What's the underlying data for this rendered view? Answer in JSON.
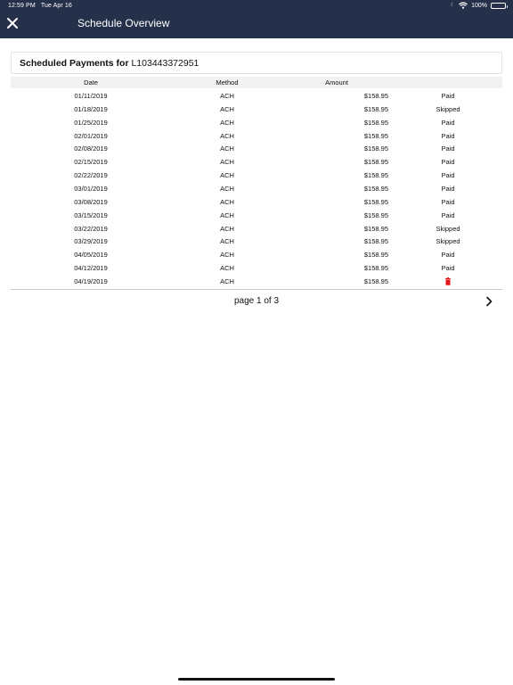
{
  "status_bar": {
    "time": "12:59 PM",
    "date": "Tue Apr 16",
    "battery": "100%",
    "battery_level": 1.0
  },
  "nav": {
    "title": "Schedule Overview",
    "close_icon": "close-icon"
  },
  "card": {
    "title_prefix": "Scheduled Payments for",
    "loan_id": "L103443372951"
  },
  "table": {
    "columns": [
      "Date",
      "Method",
      "Amount"
    ],
    "rows": [
      {
        "date": "01/11/2019",
        "method": "ACH",
        "amount": "$158.95",
        "status": "Paid"
      },
      {
        "date": "01/18/2019",
        "method": "ACH",
        "amount": "$158.95",
        "status": "Skipped"
      },
      {
        "date": "01/25/2019",
        "method": "ACH",
        "amount": "$158.95",
        "status": "Paid"
      },
      {
        "date": "02/01/2019",
        "method": "ACH",
        "amount": "$158.95",
        "status": "Paid"
      },
      {
        "date": "02/08/2019",
        "method": "ACH",
        "amount": "$158.95",
        "status": "Paid"
      },
      {
        "date": "02/15/2019",
        "method": "ACH",
        "amount": "$158.95",
        "status": "Paid"
      },
      {
        "date": "02/22/2019",
        "method": "ACH",
        "amount": "$158.95",
        "status": "Paid"
      },
      {
        "date": "03/01/2019",
        "method": "ACH",
        "amount": "$158.95",
        "status": "Paid"
      },
      {
        "date": "03/08/2019",
        "method": "ACH",
        "amount": "$158.95",
        "status": "Paid"
      },
      {
        "date": "03/15/2019",
        "method": "ACH",
        "amount": "$158.95",
        "status": "Paid"
      },
      {
        "date": "03/22/2019",
        "method": "ACH",
        "amount": "$158.95",
        "status": "Skipped"
      },
      {
        "date": "03/29/2019",
        "method": "ACH",
        "amount": "$158.95",
        "status": "Skipped"
      },
      {
        "date": "04/05/2019",
        "method": "ACH",
        "amount": "$158.95",
        "status": "Paid"
      },
      {
        "date": "04/12/2019",
        "method": "ACH",
        "amount": "$158.95",
        "status": "Paid"
      },
      {
        "date": "04/19/2019",
        "method": "ACH",
        "amount": "$158.95",
        "status": "",
        "action_icon": "trash-icon"
      }
    ]
  },
  "pagination": {
    "label": "page 1 of 3",
    "next_icon": "chevron-right-icon"
  },
  "colors": {
    "nav_background": "#25304a",
    "delete_red": "#e8141c",
    "header_row": "#f2f2f2"
  }
}
